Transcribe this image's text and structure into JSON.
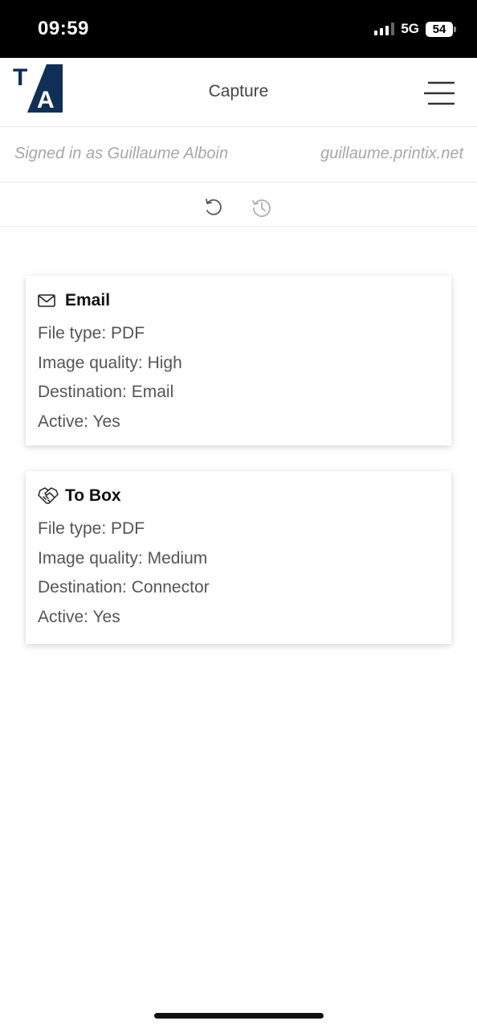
{
  "status_bar": {
    "time": "09:59",
    "network": "5G",
    "battery": "54"
  },
  "header": {
    "title": "Capture",
    "logo_text": "TA"
  },
  "account": {
    "signed_in_text": "Signed in as Guillaume Alboin",
    "domain": "guillaume.printix.net"
  },
  "workflows": [
    {
      "icon": "envelope-icon",
      "title": "Email",
      "file_type": "File type: PDF",
      "image_quality": "Image quality: High",
      "destination": "Destination: Email",
      "active": "Active: Yes"
    },
    {
      "icon": "handshake-icon",
      "title": "To Box",
      "file_type": "File type: PDF",
      "image_quality": "Image quality: Medium",
      "destination": "Destination: Connector",
      "active": "Active: Yes"
    }
  ],
  "colors": {
    "brand_navy": "#0f2f57",
    "muted_text": "#a7a7a7"
  }
}
